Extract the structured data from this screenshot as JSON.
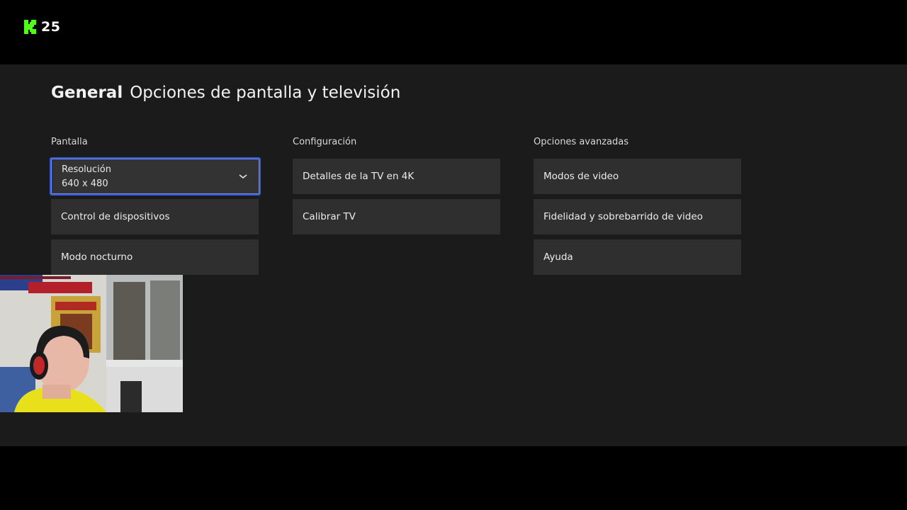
{
  "overlay": {
    "viewer_count": "25",
    "brand_color": "#53fc18"
  },
  "page": {
    "section": "General",
    "title": "Opciones de pantalla y televisión"
  },
  "columns": [
    {
      "header": "Pantalla",
      "items": [
        {
          "label": "Resolución",
          "value": "640 x 480",
          "type": "dropdown",
          "focused": true
        },
        {
          "label": "Control de dispositivos"
        },
        {
          "label": "Modo nocturno"
        }
      ]
    },
    {
      "header": "Configuración",
      "items": [
        {
          "label": "Detalles de la TV en 4K"
        },
        {
          "label": "Calibrar TV"
        }
      ]
    },
    {
      "header": "Opciones avanzadas",
      "items": [
        {
          "label": "Modos de video"
        },
        {
          "label": "Fidelidad y sobrebarrido de video"
        },
        {
          "label": "Ayuda"
        }
      ]
    }
  ],
  "icons": {
    "logo": "kick-logo-icon",
    "dropdown": "chevron-down-icon"
  },
  "colors": {
    "focus_border": "#3a5bd9",
    "tile_bg": "#2f2f2f",
    "panel_bg": "#1b1b1b"
  }
}
